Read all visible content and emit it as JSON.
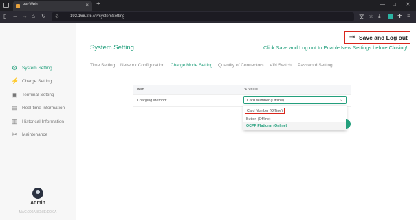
{
  "browser": {
    "tab_title": "evcWeb",
    "tab_close": "×",
    "new_tab": "+",
    "url": "192.168.2.57/#/systemSetting",
    "window_controls": [
      "—",
      "□",
      "✕"
    ]
  },
  "header": {
    "title": "System Setting",
    "save_button": "Save and Log out",
    "hint": "Click Save and Log out to Enable New Settings before Closing!"
  },
  "tabs": [
    "Time Setting",
    "Network Configuration",
    "Charge Mode Setting",
    "Quantity of Connectors",
    "VIN Switch",
    "Password Setting"
  ],
  "active_tab": "Charge Mode Setting",
  "sidebar": {
    "items": [
      {
        "label": "System Setting",
        "icon": "gear-icon",
        "active": true
      },
      {
        "label": "Charge Setting",
        "icon": "plug-icon",
        "active": false
      },
      {
        "label": "Terminal Setting",
        "icon": "terminal-icon",
        "active": false
      },
      {
        "label": "Real-time Information",
        "icon": "monitor-icon",
        "active": false
      },
      {
        "label": "Historical Information",
        "icon": "history-icon",
        "active": false
      },
      {
        "label": "Maintenance",
        "icon": "wrench-icon",
        "active": false
      }
    ],
    "user_name": "Admin",
    "mac": "MAC:000A:8D:8E:D0:0A"
  },
  "table": {
    "headers": [
      "Item",
      "Value"
    ],
    "rows": [
      {
        "label": "Charging Method:",
        "value": "Card Number (Offline)"
      }
    ]
  },
  "dropdown": {
    "options": [
      "Card Number (Offline)",
      "Button (Offline)",
      "OCPP Platform (Online)"
    ]
  },
  "colors": {
    "accent": "#24a07d",
    "highlight": "#d9261c"
  }
}
